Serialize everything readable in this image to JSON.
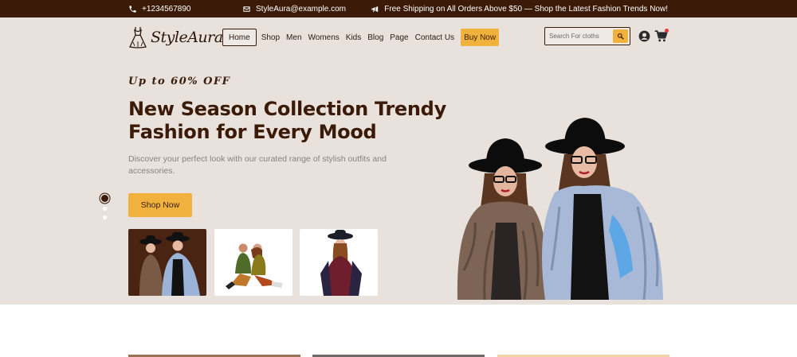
{
  "topbar": {
    "phone": "+1234567890",
    "email": "StyleAura@example.com",
    "shipping": "Free Shipping on All Orders Above $50 — Shop the Latest Fashion Trends Now!"
  },
  "brand": {
    "name": "StyleAura"
  },
  "nav": {
    "items": [
      "Home",
      "Shop",
      "Men",
      "Womens",
      "Kids",
      "Blog",
      "Page",
      "Contact Us"
    ],
    "active": "Home",
    "cta": "Buy Now"
  },
  "search": {
    "placeholder": "Search For cloths"
  },
  "hero": {
    "promo": "Up to 60% OFF",
    "headline": "New Season Collection Trendy Fashion for Every Mood",
    "description": "Discover your perfect look with our curated range of stylish outfits and accessories.",
    "button": "Shop Now",
    "slides_total": 3,
    "active_slide": 1
  },
  "colors": {
    "topbar": "#3b1a07",
    "hero_bg": "#e8e1dc",
    "accent": "#f0b23c",
    "heading": "#3b1a07",
    "badge": "#e53b3b"
  },
  "icons": [
    "phone-icon",
    "mail-icon",
    "megaphone-icon",
    "dress-logo-icon",
    "search-icon",
    "user-icon",
    "cart-icon"
  ]
}
